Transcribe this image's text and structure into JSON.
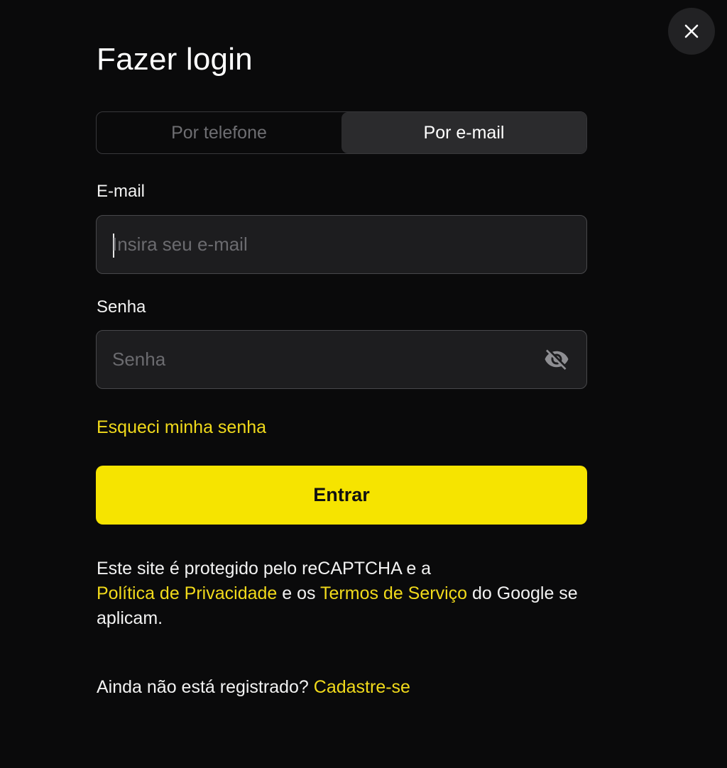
{
  "modal": {
    "title": "Fazer login",
    "close_icon": "close-icon"
  },
  "tabs": [
    {
      "label": "Por telefone",
      "active": false
    },
    {
      "label": "Por e-mail",
      "active": true
    }
  ],
  "email": {
    "label": "E-mail",
    "placeholder": "Insira seu e-mail",
    "value": ""
  },
  "password": {
    "label": "Senha",
    "placeholder": "Senha",
    "value": "",
    "toggle_icon": "eye-off-icon"
  },
  "forgot_link": "Esqueci minha senha",
  "submit_label": "Entrar",
  "recaptcha": {
    "text1": "Este site é protegido pelo reCAPTCHA e a",
    "privacy_link": "Política de Privacidade",
    "text2": " e os ",
    "terms_link": "Termos de Serviço",
    "text3": " do Google se aplicam."
  },
  "register": {
    "prompt": "Ainda não está registrado?",
    "link": "Cadastre-se"
  },
  "colors": {
    "background": "#0a0a0b",
    "accent": "#f6e400",
    "link": "#f1da1b",
    "field_bg": "#1d1d1f"
  }
}
